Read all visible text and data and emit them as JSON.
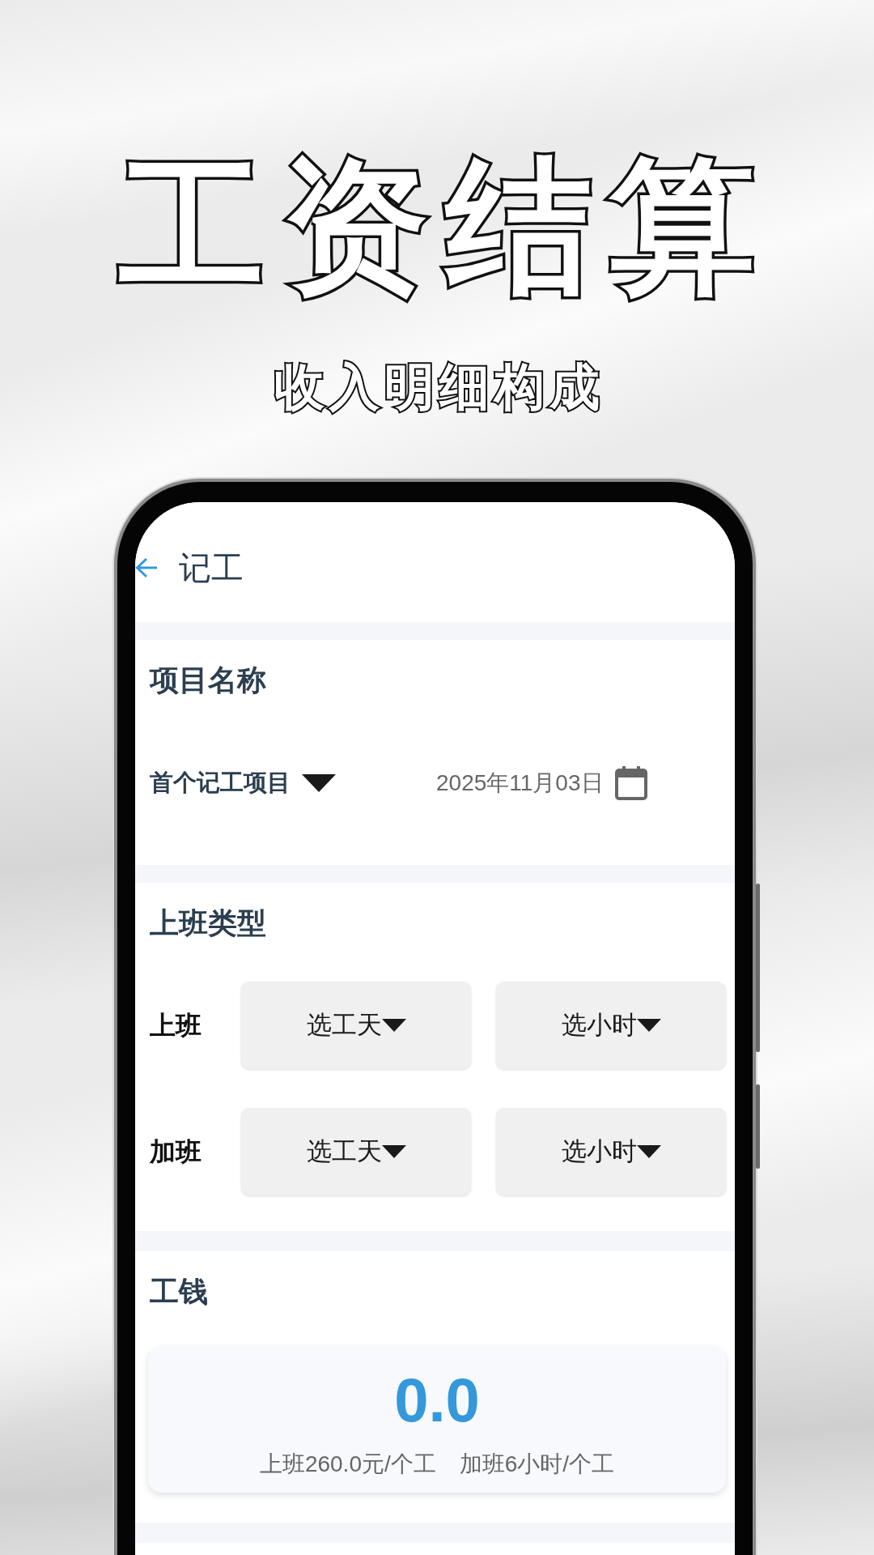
{
  "headline": {
    "title": "工资结算",
    "subtitle": "收入明细构成"
  },
  "header": {
    "title": "记工"
  },
  "project_section": {
    "heading": "项目名称",
    "project_dropdown": "首个记工项目",
    "date": "2025年11月03日"
  },
  "shift_section": {
    "heading": "上班类型",
    "rows": [
      {
        "label": "上班",
        "day_dropdown": "选工天",
        "hour_dropdown": "选小时"
      },
      {
        "label": "加班",
        "day_dropdown": "选工天",
        "hour_dropdown": "选小时"
      }
    ]
  },
  "wage_section": {
    "heading": "工钱",
    "amount": "0.0",
    "rates": [
      "上班260.0元/个工",
      "加班6小时/个工"
    ]
  }
}
